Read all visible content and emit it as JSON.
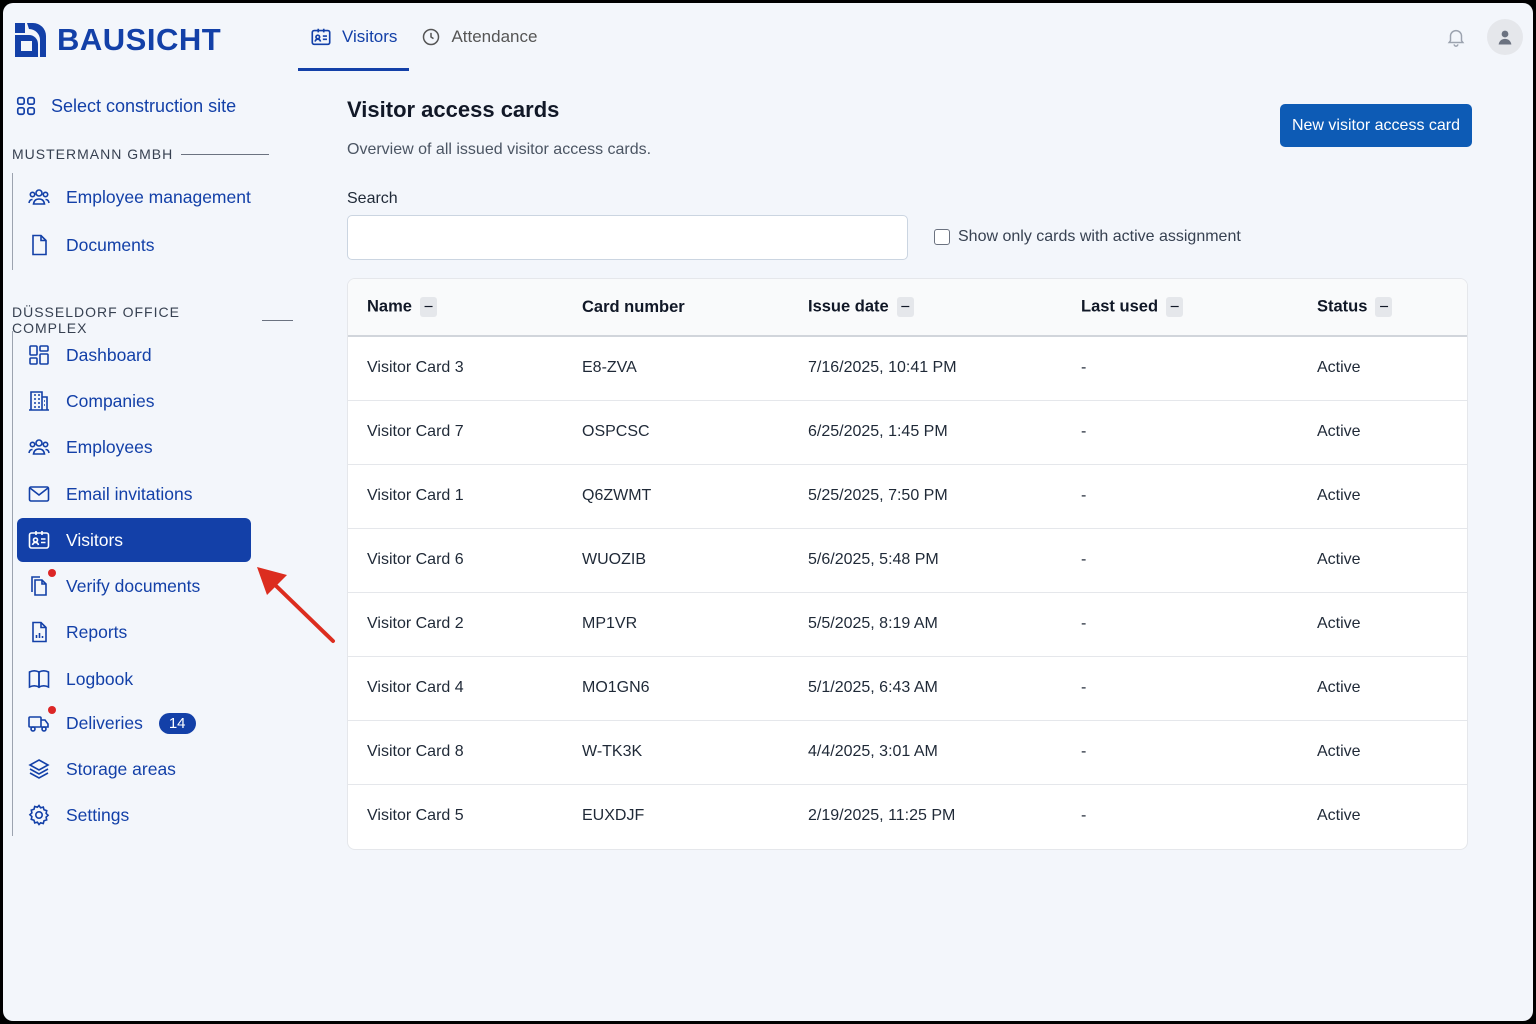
{
  "app": {
    "name": "BAUSICHT"
  },
  "topnav": {
    "tabs": [
      {
        "label": "Visitors"
      },
      {
        "label": "Attendance"
      }
    ]
  },
  "sidebar": {
    "select_site": "Select construction site",
    "company_section": "MUSTERMANN GMBH",
    "company_items": [
      {
        "label": "Employee management"
      },
      {
        "label": "Documents"
      }
    ],
    "site_section": "DÜSSELDORF OFFICE COMPLEX",
    "site_items": [
      {
        "label": "Dashboard"
      },
      {
        "label": "Companies"
      },
      {
        "label": "Employees"
      },
      {
        "label": "Email invitations"
      },
      {
        "label": "Visitors"
      },
      {
        "label": "Verify documents"
      },
      {
        "label": "Reports"
      },
      {
        "label": "Logbook"
      },
      {
        "label": "Deliveries",
        "badge": "14"
      },
      {
        "label": "Storage areas"
      },
      {
        "label": "Settings"
      }
    ]
  },
  "main": {
    "title": "Visitor access cards",
    "subtitle": "Overview of all issued visitor access cards.",
    "new_button": "New visitor access card",
    "search_label": "Search",
    "search_value": "",
    "filter_label": "Show only cards with active assignment",
    "table": {
      "headers": [
        "Name",
        "Card number",
        "Issue date",
        "Last used",
        "Status"
      ],
      "sort_indicator": "−",
      "rows": [
        [
          "Visitor Card 3",
          "E8-ZVA",
          "7/16/2025, 10:41 PM",
          "-",
          "Active"
        ],
        [
          "Visitor Card 7",
          "OSPCSC",
          "6/25/2025, 1:45 PM",
          "-",
          "Active"
        ],
        [
          "Visitor Card 1",
          "Q6ZWMT",
          "5/25/2025, 7:50 PM",
          "-",
          "Active"
        ],
        [
          "Visitor Card 6",
          "WUOZIB",
          "5/6/2025, 5:48 PM",
          "-",
          "Active"
        ],
        [
          "Visitor Card 2",
          "MP1VR",
          "5/5/2025, 8:19 AM",
          "-",
          "Active"
        ],
        [
          "Visitor Card 4",
          "MO1GN6",
          "5/1/2025, 6:43 AM",
          "-",
          "Active"
        ],
        [
          "Visitor Card 8",
          "W-TK3K",
          "4/4/2025, 3:01 AM",
          "-",
          "Active"
        ],
        [
          "Visitor Card 5",
          "EUXDJF",
          "2/19/2025, 11:25 PM",
          "-",
          "Active"
        ]
      ]
    }
  },
  "colors": {
    "brand": "#1340a8",
    "primary_button": "#0d5bb5",
    "notification_dot": "#dc2626",
    "annotation_arrow": "#dc2d1f"
  }
}
